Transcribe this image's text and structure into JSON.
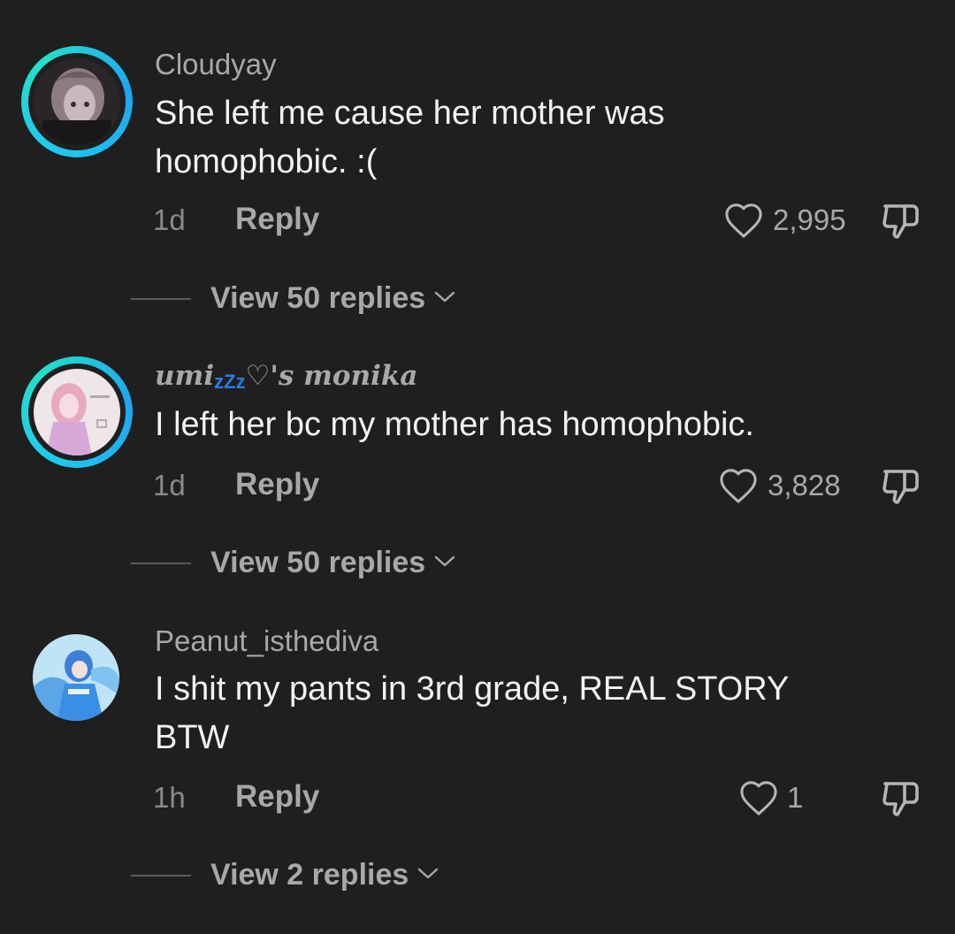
{
  "comments": [
    {
      "username": "Cloudyay",
      "text_line1": "She left me cause her mother was",
      "text_line2": "homophobic. :(",
      "time": "1d",
      "reply_label": "Reply",
      "likes": "2,995",
      "view_replies": "View 50 replies",
      "avatar_ring": true
    },
    {
      "username_prefix": "umi",
      "username_zz": "zZz",
      "username_suffix": "♡'s monika",
      "text_line1": "I left her bc my mother has homophobic.",
      "time": "1d",
      "reply_label": "Reply",
      "likes": "3,828",
      "view_replies": "View 50 replies",
      "avatar_ring": true
    },
    {
      "username": "Peanut_isthediva",
      "text_line1": "I shit my pants in 3rd grade, REAL STORY",
      "text_line2": "BTW",
      "time": "1h",
      "reply_label": "Reply",
      "likes": "1",
      "view_replies": "View 2 replies",
      "avatar_ring": false
    }
  ],
  "icons": {
    "like": "heart-outline-icon",
    "dislike": "thumbs-down-outline-icon",
    "expand": "chevron-down-icon"
  },
  "colors": {
    "background": "#1f1f1f",
    "ring_gradient": [
      "#1ec8f0",
      "#23e0c8"
    ],
    "secondary_text": "#a8a8a8"
  }
}
